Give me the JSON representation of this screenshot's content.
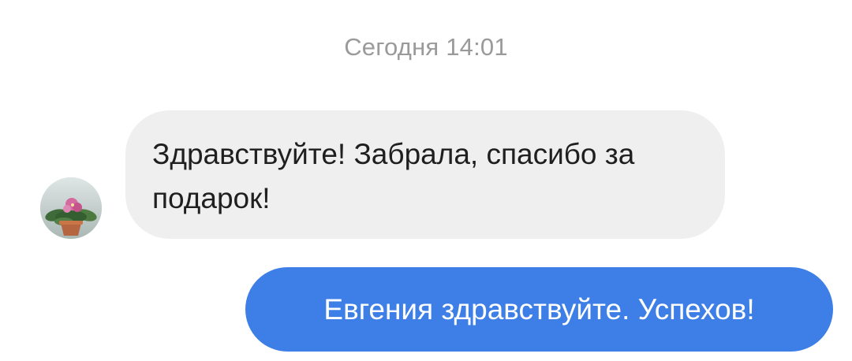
{
  "chat": {
    "date_divider": "Сегодня 14:01",
    "messages": [
      {
        "direction": "incoming",
        "text": "Здравствуйте! Забрала, спасибо за подарок!",
        "avatar_icon": "flower-pot-avatar"
      },
      {
        "direction": "outgoing",
        "text": "Евгения здравствуйте. Успехов!"
      }
    ]
  },
  "colors": {
    "background": "#ffffff",
    "incoming_bubble": "#efefef",
    "outgoing_bubble": "#3d7fe6",
    "timestamp_text": "#9a9a9a"
  }
}
